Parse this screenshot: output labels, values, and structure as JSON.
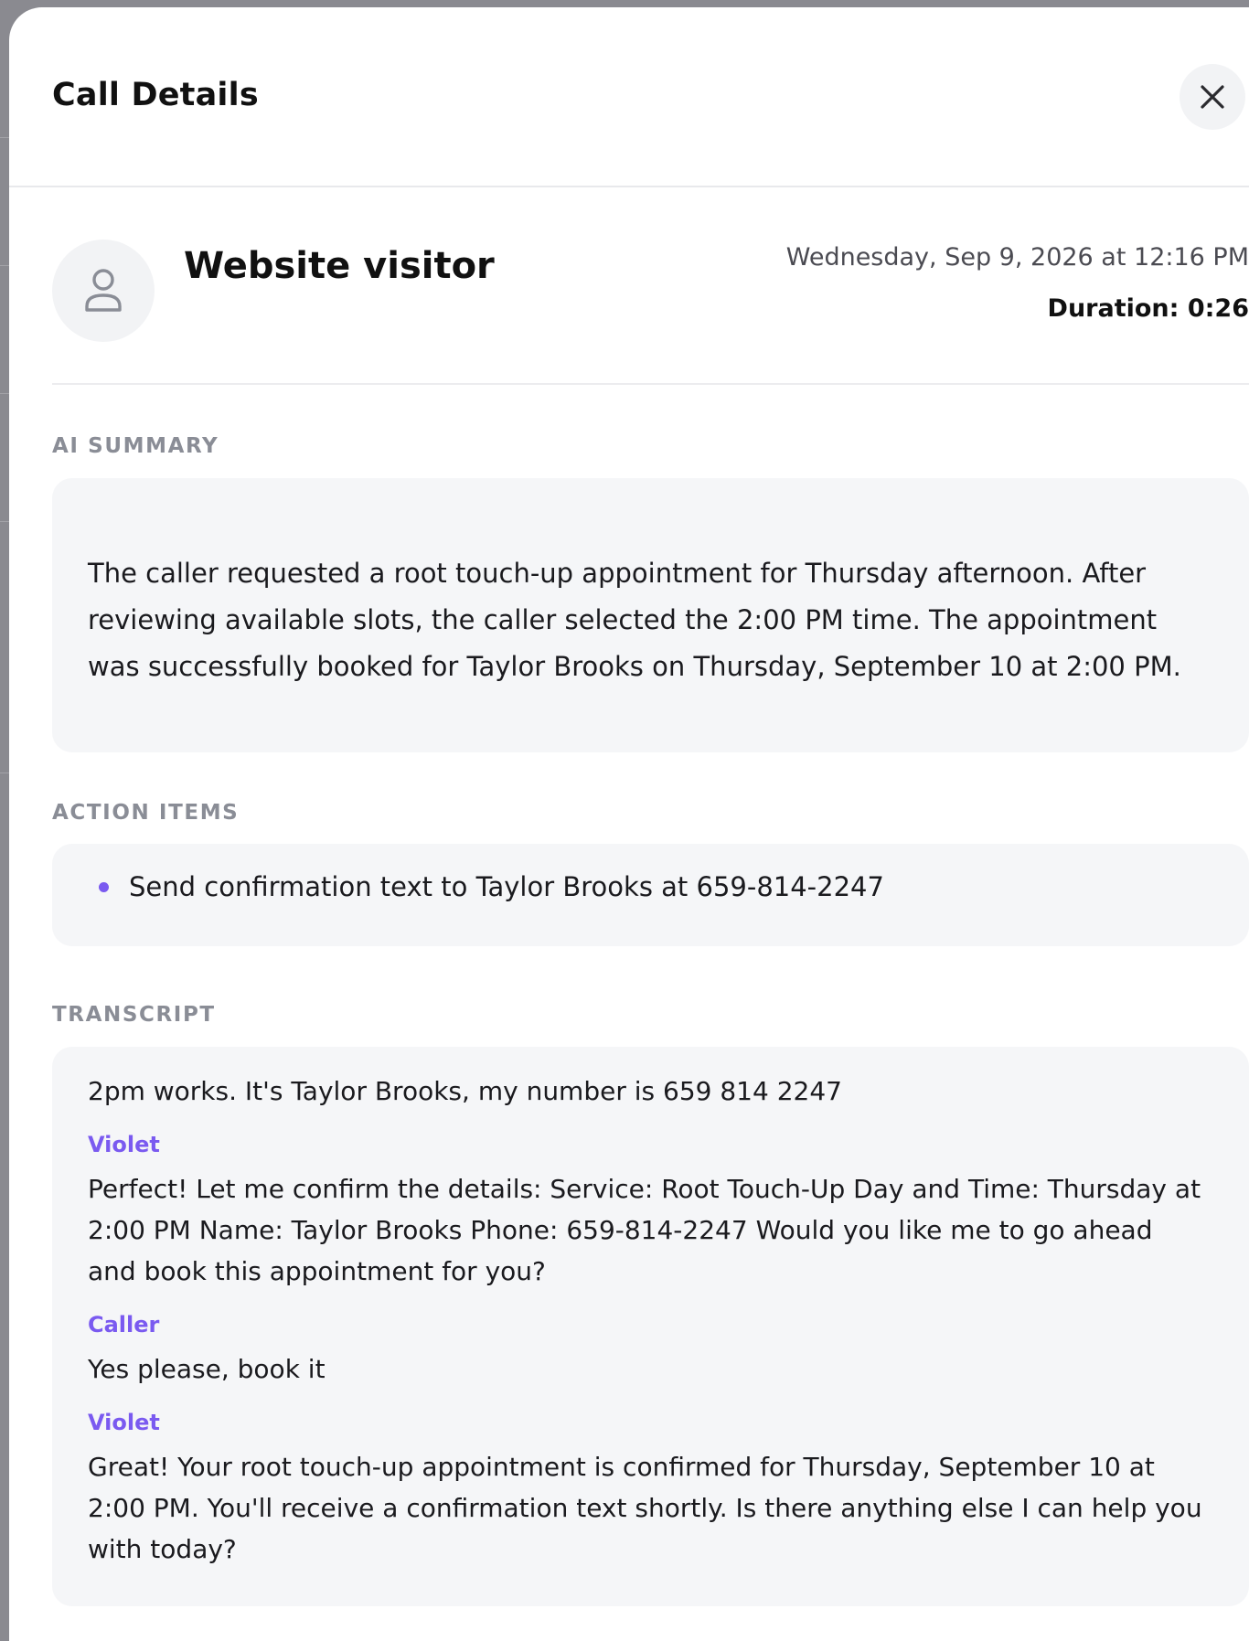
{
  "header": {
    "title": "Call Details",
    "close_icon": "close-icon"
  },
  "caller": {
    "avatar_icon": "user-icon",
    "name": "Website visitor",
    "date": "Wednesday, Sep 9, 2026 at 12:16 PM",
    "duration": "Duration: 0:26"
  },
  "summary": {
    "label": "AI SUMMARY",
    "text": "The caller requested a root touch-up appointment for Thursday afternoon. After reviewing available slots, the caller selected the 2:00 PM time. The appointment was successfully booked for Taylor Brooks on Thursday, September 10 at 2:00 PM."
  },
  "action_items": {
    "label": "ACTION ITEMS",
    "items": [
      "Send confirmation text to Taylor Brooks at 659-814-2247"
    ]
  },
  "transcript": {
    "label": "TRANSCRIPT",
    "messages": [
      {
        "speaker": "",
        "text": "2pm works. It's Taylor Brooks, my number is 659 814 2247"
      },
      {
        "speaker": "Violet",
        "text": "Perfect! Let me confirm the details: Service: Root Touch-Up Day and Time: Thursday at 2:00 PM Name: Taylor Brooks Phone: 659-814-2247 Would you like me to go ahead and book this appointment for you?"
      },
      {
        "speaker": "Caller",
        "text": "Yes please, book it"
      },
      {
        "speaker": "Violet",
        "text": "Great! Your root touch-up appointment is confirmed for Thursday, September 10 at 2:00 PM. You'll receive a confirmation text shortly. Is there anything else I can help you with today?"
      }
    ]
  },
  "colors": {
    "accent": "#7a5af0",
    "card_bg": "#f5f6f8",
    "label_gray": "#8a8d96"
  }
}
